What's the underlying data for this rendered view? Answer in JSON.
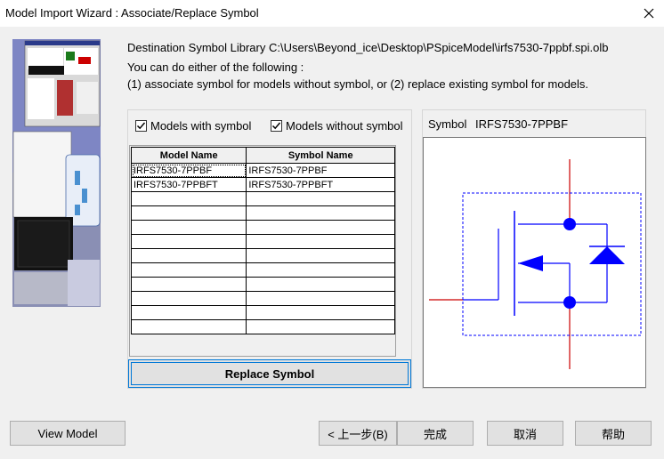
{
  "window": {
    "title": "Model Import Wizard : Associate/Replace Symbol"
  },
  "info": {
    "destination": "Destination Symbol Library C:\\Users\\Beyond_ice\\Desktop\\PSpiceModel\\irfs7530-7ppbf.spi.olb",
    "line1": "You can do either of the following :",
    "line2": "(1) associate symbol for models without symbol, or (2) replace existing symbol for models."
  },
  "filters": {
    "with_symbol": {
      "label": "Models with symbol",
      "checked": true
    },
    "without_symbol": {
      "label": "Models without symbol",
      "checked": true
    }
  },
  "grid": {
    "headers": [
      "Model Name",
      "Symbol Name"
    ],
    "rows": [
      [
        "IRFS7530-7PPBF",
        "IRFS7530-7PPBF"
      ],
      [
        "IRFS7530-7PPBFT",
        "IRFS7530-7PPBFT"
      ]
    ]
  },
  "replace_button": "Replace Symbol",
  "symbol": {
    "label": "Symbol",
    "name": "IRFS7530-7PPBF"
  },
  "buttons": {
    "view_model": "View Model",
    "back": "< 上一步(B)",
    "finish": "完成",
    "cancel": "取消",
    "help": "帮助"
  },
  "colors": {
    "symbol_blue": "#0000ff",
    "pin_red": "#cc0000",
    "focus_blue": "#0078d7"
  }
}
